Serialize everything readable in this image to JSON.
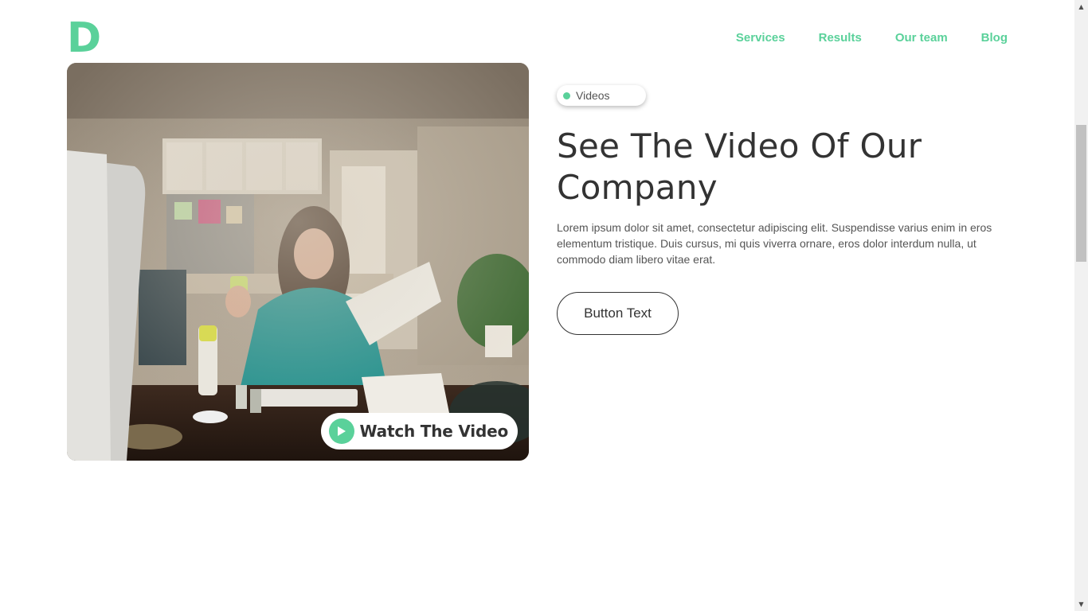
{
  "header": {
    "logo": "D",
    "nav": [
      "Services",
      "Results",
      "Our team",
      "Blog"
    ]
  },
  "media": {
    "watch_label": "Watch The Video",
    "play_icon": "play-icon"
  },
  "content": {
    "tag": "Videos",
    "heading": "See The Video Of Our Company",
    "body": "Lorem ipsum dolor sit amet, consectetur adipiscing elit. Suspendisse varius enim in eros elementum tristique. Duis cursus, mi quis viverra ornare, eros dolor interdum nulla, ut commodo diam libero vitae erat.",
    "button": "Button Text"
  },
  "colors": {
    "accent": "#5ad19a",
    "text": "#333333"
  }
}
